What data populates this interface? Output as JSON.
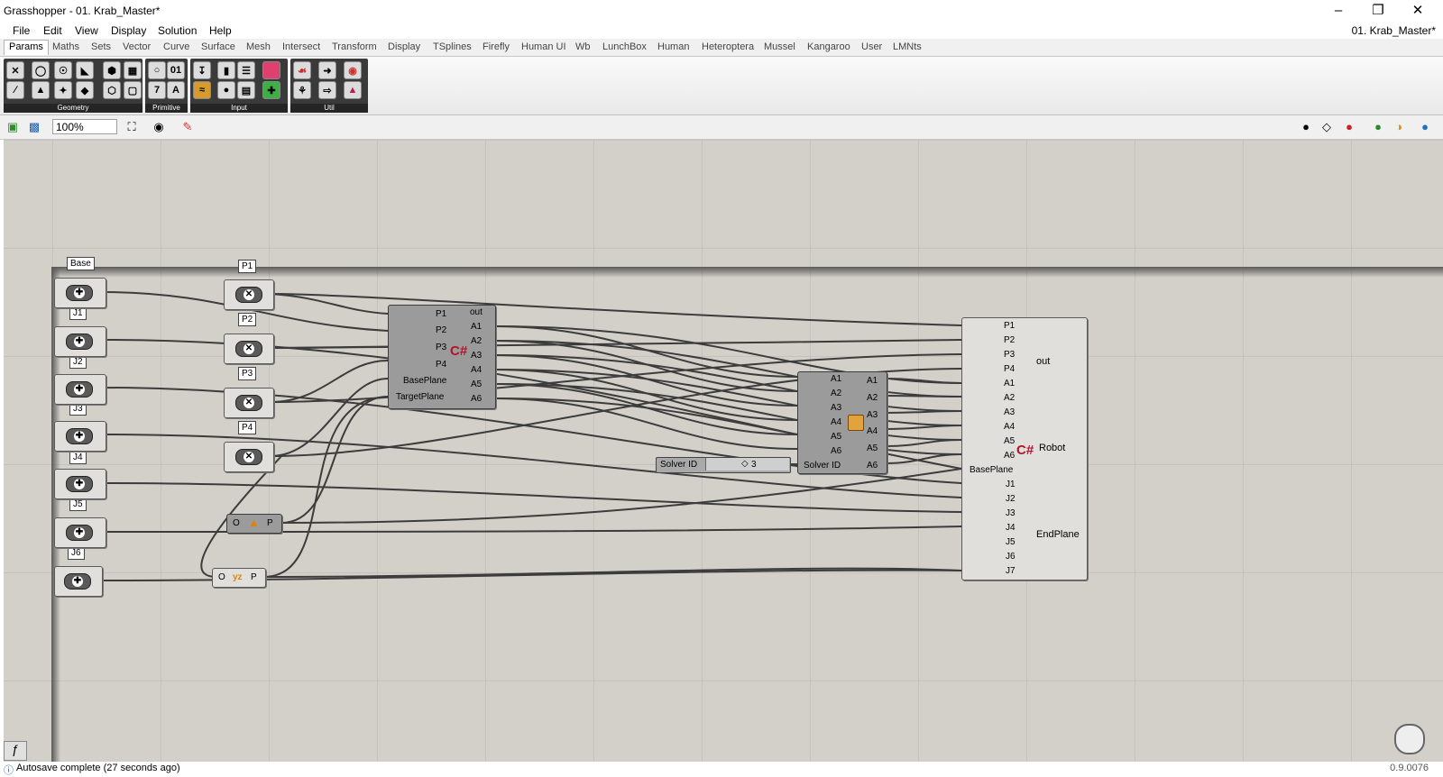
{
  "window": {
    "title": "Grasshopper - 01. Krab_Master*",
    "doc_name": "01. Krab_Master*"
  },
  "menu": [
    "File",
    "Edit",
    "View",
    "Display",
    "Solution",
    "Help"
  ],
  "tabs": [
    "Params",
    "Maths",
    "Sets",
    "Vector",
    "Curve",
    "Surface",
    "Mesh",
    "Intersect",
    "Transform",
    "Display",
    "TSplines",
    "Firefly",
    "Human UI",
    "Wb",
    "LunchBox",
    "Human",
    "Heteroptera",
    "Mussel",
    "Kangaroo",
    "User",
    "LMNts"
  ],
  "ribbon_groups": [
    "Geometry",
    "Primitive",
    "Input",
    "Util"
  ],
  "toolbar": {
    "zoom": "100%"
  },
  "canvas": {
    "param_labels": [
      "Base",
      "J1",
      "J2",
      "J3",
      "J4",
      "J5",
      "J6"
    ],
    "point_labels": [
      "P1",
      "P2",
      "P3",
      "P4"
    ],
    "csharp1": {
      "inputs": [
        "P1",
        "P2",
        "P3",
        "P4",
        "BasePlane",
        "TargetPlane"
      ],
      "outputs": [
        "out",
        "A1",
        "A2",
        "A3",
        "A4",
        "A5",
        "A6"
      ]
    },
    "cluster": {
      "inputs": [
        "A1",
        "A2",
        "A3",
        "A4",
        "A5",
        "A6",
        "Solver ID"
      ],
      "outputs": [
        "A1",
        "A2",
        "A3",
        "A4",
        "A5",
        "A6"
      ]
    },
    "slider": {
      "label": "Solver ID",
      "value": "3"
    },
    "plane1": {
      "in": "O",
      "out": "P"
    },
    "plane2": {
      "in": "O",
      "mid": "yz",
      "out": "P"
    },
    "robot": {
      "inputs": [
        "P1",
        "P2",
        "P3",
        "P4",
        "A1",
        "A2",
        "A3",
        "A4",
        "A5",
        "A6",
        "BasePlane",
        "J1",
        "J2",
        "J3",
        "J4",
        "J5",
        "J6",
        "J7"
      ],
      "outputs": [
        "out",
        "Robot",
        "EndPlane"
      ]
    }
  },
  "status": {
    "message": "Autosave complete (27 seconds ago)",
    "version": "0.9.0076"
  }
}
